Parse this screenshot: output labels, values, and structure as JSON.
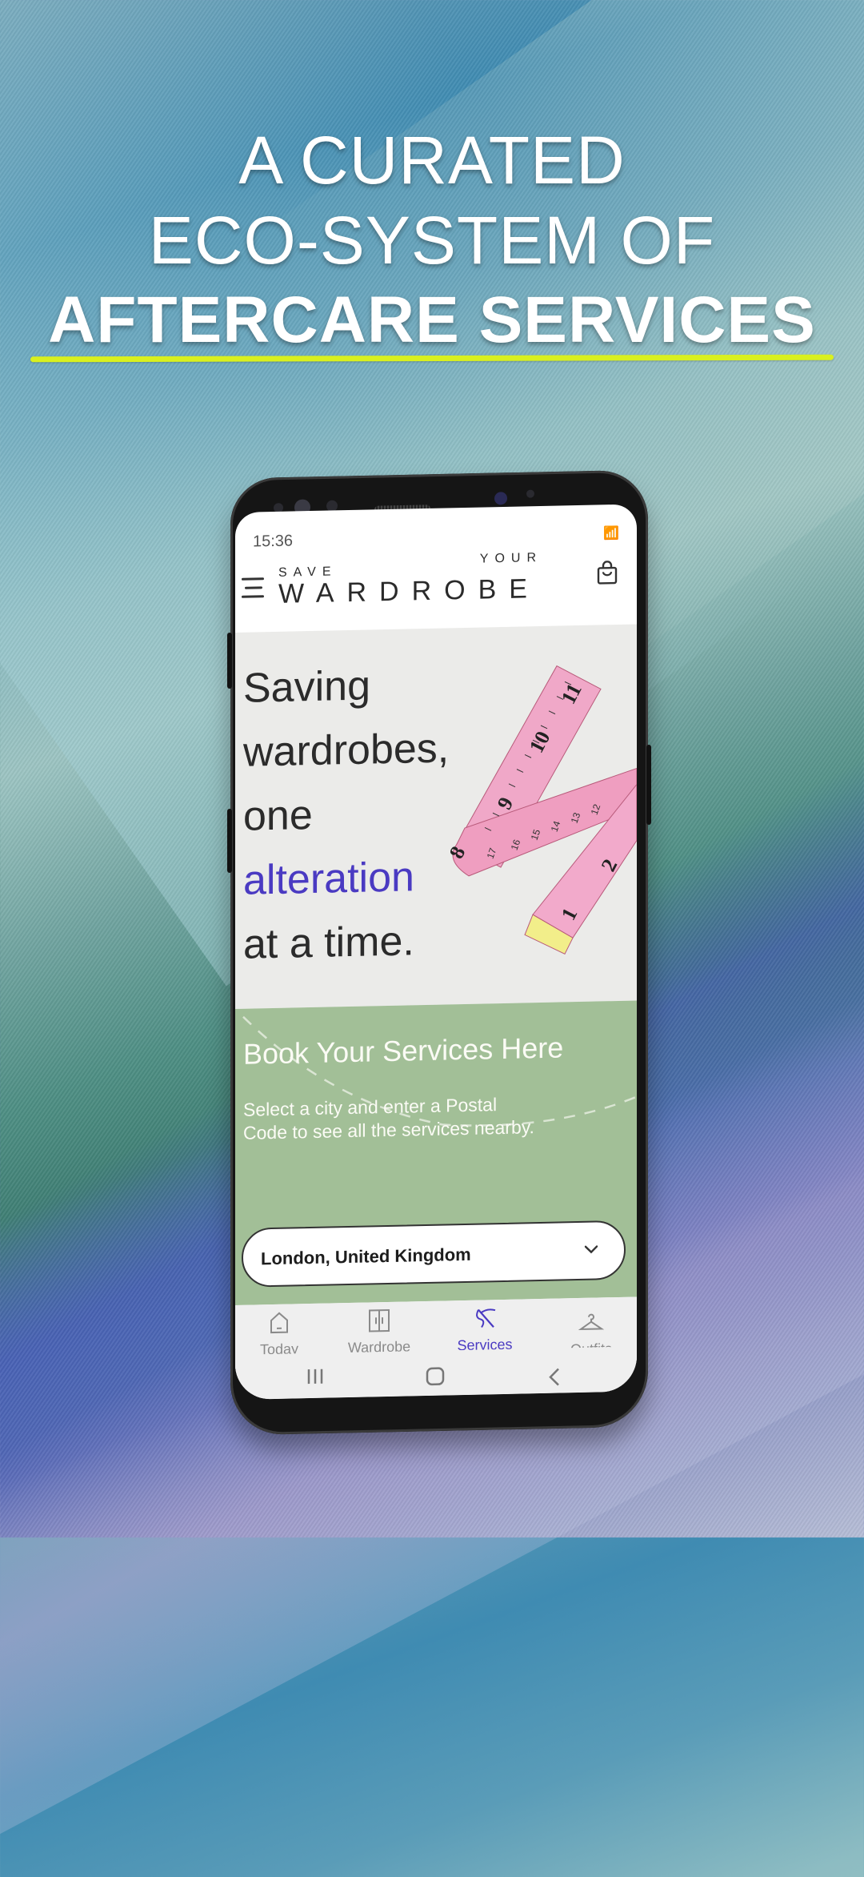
{
  "headline": {
    "line1": "A CURATED",
    "line2": "ECO-SYSTEM OF",
    "line3": "AFTERCARE SERVICES",
    "underline_color": "#d9f01f"
  },
  "status_bar": {
    "time": "15:36",
    "icons": [
      "wifi-icon",
      "signal-icon",
      "battery-charging-icon"
    ]
  },
  "app_bar": {
    "logo_small_left": "SAVE",
    "logo_small_right": "YOUR",
    "logo_main": "WARDROBE",
    "menu_icon": "hamburger-menu-icon",
    "bag_icon": "shopping-bag-icon"
  },
  "hero": {
    "line1": "Saving",
    "line2": "wardrobes,",
    "line3": "one",
    "line4_accent": "alteration",
    "line5": "at a time.",
    "accent_color": "#4a3ac2",
    "image": "measuring-tape-image"
  },
  "booking": {
    "title": "Book Your Services Here",
    "subtitle": "Select a city and enter a Postal Code to see all the services nearby.",
    "city_select": {
      "value": "London, United Kingdom",
      "icon": "chevron-down-icon"
    },
    "background_color": "#a2bf97"
  },
  "tabs": [
    {
      "label": "Today",
      "icon": "home-icon",
      "active": false
    },
    {
      "label": "Wardrobe",
      "icon": "wardrobe-icon",
      "active": false
    },
    {
      "label": "Services",
      "icon": "sewing-needle-icon",
      "active": true
    },
    {
      "label": "Outfits",
      "icon": "hanger-icon",
      "active": false
    }
  ],
  "system_nav": [
    "recent-apps-icon",
    "home-button-icon",
    "back-icon"
  ]
}
